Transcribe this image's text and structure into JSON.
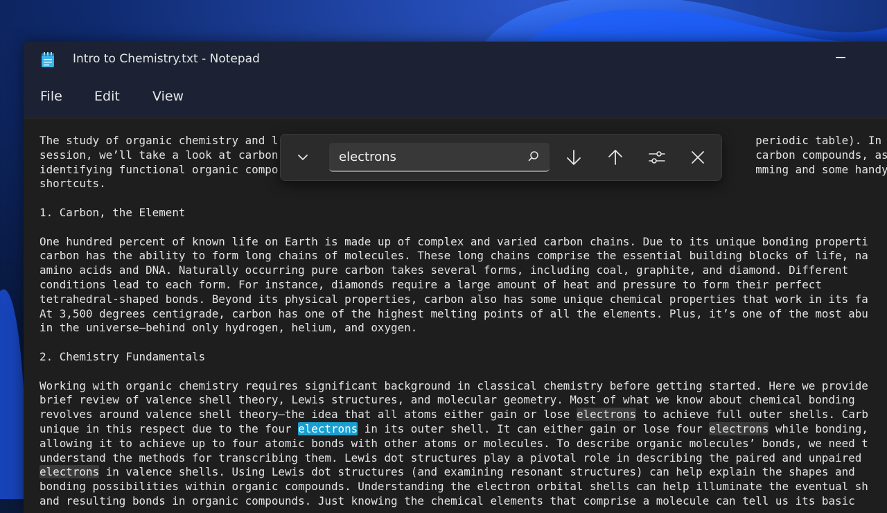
{
  "window": {
    "title": "Intro to Chemistry.txt - Notepad"
  },
  "menu": {
    "file": "File",
    "edit": "Edit",
    "view": "View"
  },
  "find": {
    "query": "electrons"
  },
  "colors": {
    "match_highlight": "#3a3a3a",
    "current_match": "#1a9fd0",
    "editor_bg": "#1e1e1e",
    "titlebar_bg": "#1c2233"
  },
  "document": {
    "lines": [
      [
        {
          "t": "The study of organic chemistry and l"
        },
        {
          "t": "                                                                        periodic table). In this"
        }
      ],
      [
        {
          "t": "session, we’ll take a look at carbon"
        },
        {
          "t": "                                                                        carbon compounds, as we"
        }
      ],
      [
        {
          "t": "identifying functional organic compo"
        },
        {
          "t": "                                                                        mming and some handy"
        }
      ],
      [
        {
          "t": "shortcuts."
        }
      ],
      [
        {
          "t": ""
        }
      ],
      [
        {
          "t": "1. Carbon, the Element"
        }
      ],
      [
        {
          "t": ""
        }
      ],
      [
        {
          "t": "One hundred percent of known life on Earth is made up of complex and varied carbon chains. Due to its unique bonding properti"
        }
      ],
      [
        {
          "t": "carbon has the ability to form long chains of molecules. These long chains comprise the essential building blocks of life, na"
        }
      ],
      [
        {
          "t": "amino acids and DNA. Naturally occurring pure carbon takes several forms, including coal, graphite, and diamond. Different"
        }
      ],
      [
        {
          "t": "conditions lead to each form. For instance, diamonds require a large amount of heat and pressure to form their perfect"
        }
      ],
      [
        {
          "t": "tetrahedral-shaped bonds. Beyond its physical properties, carbon also has some unique chemical properties that work in its fa"
        }
      ],
      [
        {
          "t": "At 3,500 degrees centigrade, carbon has one of the highest melting points of all the elements. Plus, it’s one of the most abu"
        }
      ],
      [
        {
          "t": "in the universe—behind only hydrogen, helium, and oxygen."
        }
      ],
      [
        {
          "t": ""
        }
      ],
      [
        {
          "t": "2. Chemistry Fundamentals"
        }
      ],
      [
        {
          "t": ""
        }
      ],
      [
        {
          "t": "Working with organic chemistry requires significant background in classical chemistry before getting started. Here we provide"
        }
      ],
      [
        {
          "t": "brief review of valence shell theory, Lewis structures, and molecular geometry. Most of what we know about chemical bonding"
        }
      ],
      [
        {
          "t": "revolves around valence shell theory—the idea that all atoms either gain or lose "
        },
        {
          "t": "electrons",
          "h": "m"
        },
        {
          "t": " to achieve full outer shells. Carb"
        }
      ],
      [
        {
          "t": "unique in this respect due to the four "
        },
        {
          "t": "electrons",
          "h": "cur"
        },
        {
          "t": " in its outer shell. It can either gain or lose four "
        },
        {
          "t": "electrons",
          "h": "m"
        },
        {
          "t": " while bonding,"
        }
      ],
      [
        {
          "t": "allowing it to achieve up to four atomic bonds with other atoms or molecules. To describe organic molecules’ bonds, we need t"
        }
      ],
      [
        {
          "t": "understand the methods for transcribing them. Lewis dot structures play a pivotal role in describing the paired and unpaired"
        }
      ],
      [
        {
          "t": "electrons",
          "h": "m"
        },
        {
          "t": " in valence shells. Using Lewis dot structures (and examining resonant structures) can help explain the shapes and"
        }
      ],
      [
        {
          "t": "bonding possibilities within organic compounds. Understanding the electron orbital shells can help illuminate the eventual sh"
        }
      ],
      [
        {
          "t": "and resulting bonds in organic compounds. Just knowing the chemical elements that comprise a molecule can tell us its basic"
        }
      ]
    ]
  }
}
